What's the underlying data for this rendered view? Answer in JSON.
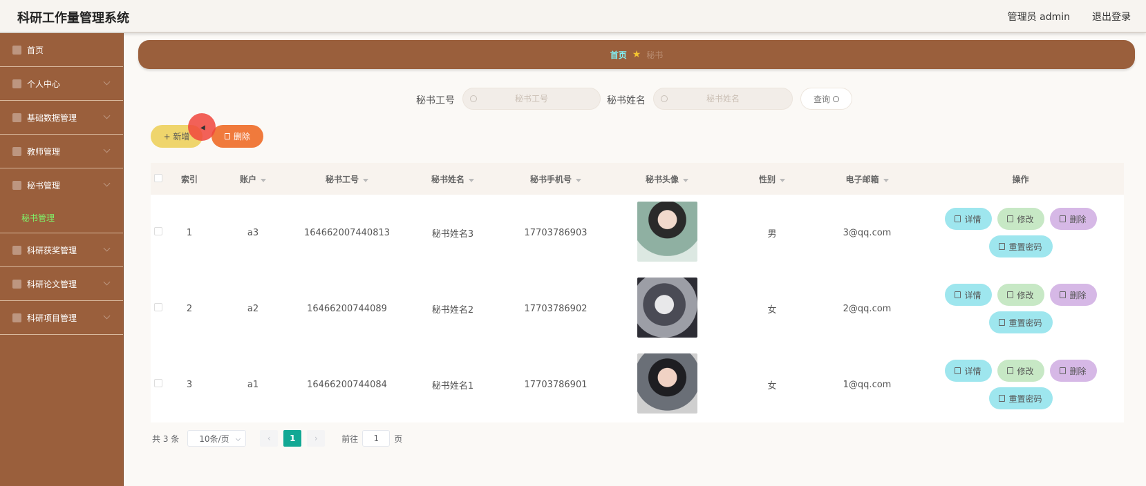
{
  "header": {
    "title": "科研工作量管理系统",
    "admin": "管理员 admin",
    "logout": "退出登录"
  },
  "sidebar": {
    "items": [
      {
        "label": "首页"
      },
      {
        "label": "个人中心"
      },
      {
        "label": "基础数据管理"
      },
      {
        "label": "教师管理"
      },
      {
        "label": "秘书管理"
      },
      {
        "label": "科研获奖管理"
      },
      {
        "label": "科研论文管理"
      },
      {
        "label": "科研项目管理"
      }
    ],
    "active_sub": "秘书管理",
    "active_color": "#7ff56a"
  },
  "breadcrumb": {
    "home": "首页",
    "current": "秘书"
  },
  "search": {
    "label_id": "秘书工号",
    "placeholder_id": "秘书工号",
    "label_name": "秘书姓名",
    "placeholder_name": "秘书姓名",
    "query": "查询"
  },
  "actions": {
    "add": "+ 新增",
    "delete": "删除"
  },
  "table": {
    "headers": {
      "index": "索引",
      "account": "账户",
      "number": "秘书工号",
      "name": "秘书姓名",
      "phone": "秘书手机号",
      "avatar": "秘书头像",
      "gender": "性别",
      "email": "电子邮箱",
      "ops": "操作"
    },
    "rows": [
      {
        "index": "1",
        "account": "a3",
        "number": "164662007440813",
        "name": "秘书姓名3",
        "phone": "17703786903",
        "gender": "男",
        "email": "3@qq.com"
      },
      {
        "index": "2",
        "account": "a2",
        "number": "16466200744089",
        "name": "秘书姓名2",
        "phone": "17703786902",
        "gender": "女",
        "email": "2@qq.com"
      },
      {
        "index": "3",
        "account": "a1",
        "number": "16466200744084",
        "name": "秘书姓名1",
        "phone": "17703786901",
        "gender": "女",
        "email": "1@qq.com"
      }
    ],
    "ops": {
      "detail": "详情",
      "edit": "修改",
      "delete": "删除",
      "reset": "重置密码"
    }
  },
  "pagination": {
    "total": "共 3 条",
    "page_size": "10条/页",
    "current_page": "1",
    "goto_prefix": "前往",
    "goto_value": "1",
    "goto_suffix": "页"
  },
  "colors": {
    "brand": "#9a5f3c",
    "accent": "#12a894",
    "add_button": "#efd56c",
    "delete_button": "#f07a3c"
  }
}
